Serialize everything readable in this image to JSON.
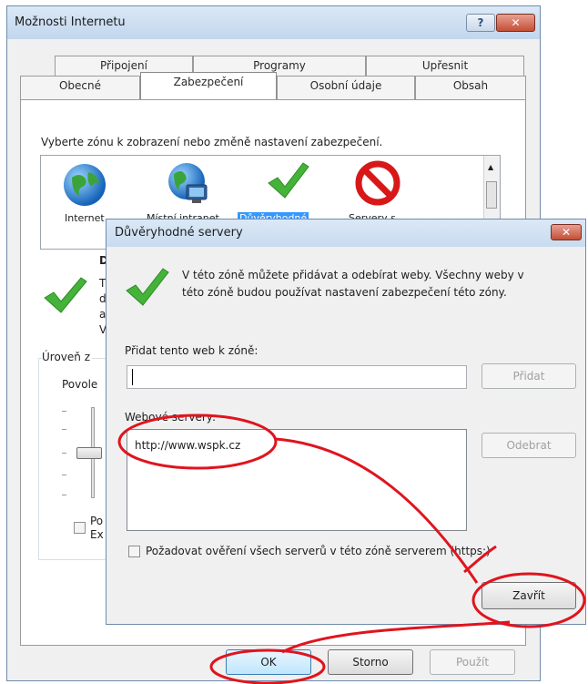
{
  "window": {
    "title": "Možnosti Internetu",
    "help_glyph": "?",
    "close_glyph": "✕"
  },
  "tabs": {
    "row_back": [
      "Připojení",
      "Programy",
      "Upřesnit"
    ],
    "row_front": [
      "Obecné",
      "Zabezpečení",
      "Osobní údaje",
      "Obsah"
    ],
    "active": "Zabezpečení"
  },
  "security": {
    "instruction": "Vyberte zónu k zobrazení nebo změně nastavení zabezpečení.",
    "zones": [
      {
        "label": "Internet",
        "icon": "globe-icon"
      },
      {
        "label": "Místní intranet",
        "icon": "intranet-icon"
      },
      {
        "label": "Důvěryhodné",
        "icon": "checkmark-icon",
        "selected": true
      },
      {
        "label": "Servery s",
        "icon": "restricted-icon"
      }
    ],
    "zone_heading_fragment": "D",
    "zone_desc_fragments": [
      "T",
      "d",
      "a",
      "V"
    ],
    "level_label_fragment": "Úroveň z",
    "allowed_fragment": "Povole",
    "protected_mode_fragments": [
      "Po",
      "Ex"
    ]
  },
  "main_buttons": {
    "ok": "OK",
    "cancel": "Storno",
    "apply": "Použít"
  },
  "trusted_dialog": {
    "title": "Důvěryhodné servery",
    "close_glyph": "✕",
    "description_lines": [
      "V této zóně můžete přidávat a odebírat weby. Všechny weby v",
      "této zóně budou používat nastavení zabezpečení této zóny."
    ],
    "add_label": "Přidat tento web k zóně:",
    "add_input_value": "",
    "add_button": "Přidat",
    "websites_label": "Webové servery:",
    "websites": [
      "http://www.wspk.cz"
    ],
    "remove_button": "Odebrat",
    "require_https_label": "Požadovat ověření všech serverů v této zóně serverem (https:)",
    "require_https_checked": false,
    "close_button": "Zavřít"
  },
  "colors": {
    "annotation_red": "#e0141e",
    "selection_blue": "#3399ff",
    "check_green": "#3fae2a"
  }
}
